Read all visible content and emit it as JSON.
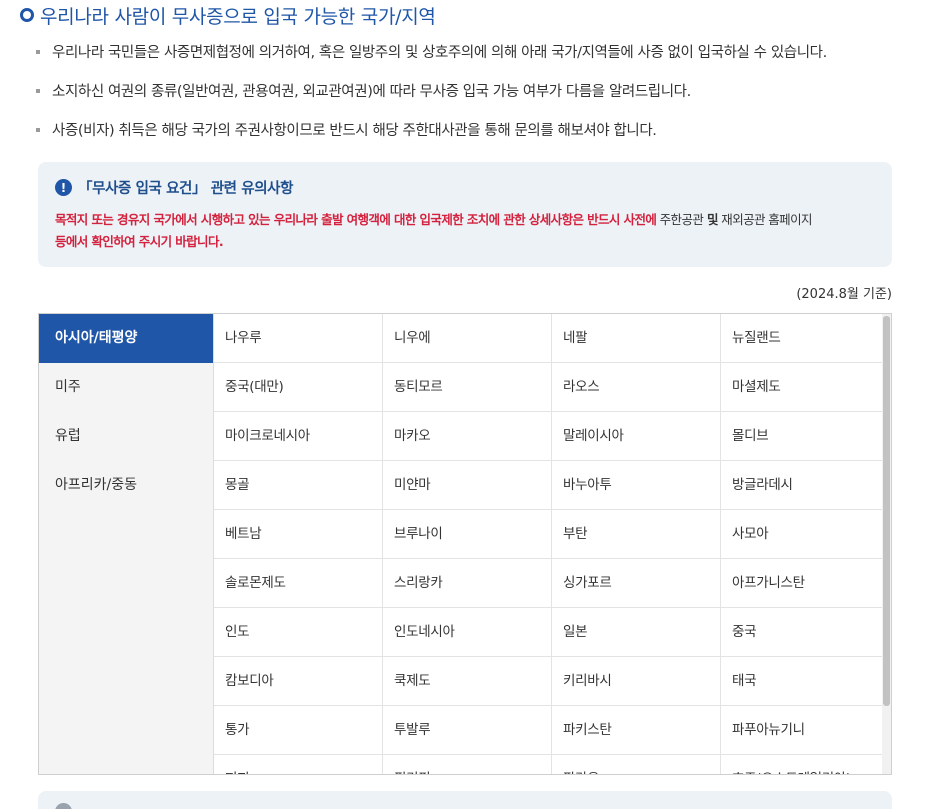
{
  "title": "우리나라 사람이 무사증으로 입국 가능한 국가/지역",
  "bullets": [
    "우리나라 국민들은 사증면제협정에 의거하여, 혹은 일방주의 및 상호주의에 의해 아래 국가/지역들에 사증 없이 입국하실 수 있습니다.",
    "소지하신 여권의 종류(일반여권, 관용여권, 외교관여권)에 따라 무사증 입국 가능 여부가 다름을 알려드립니다.",
    "사증(비자) 취득은 해당 국가의 주권사항이므로 반드시 해당 주한대사관을 통해 문의를 해보셔야 합니다."
  ],
  "notice": {
    "icon": "exclamation-icon",
    "title": "「무사증 입국 요건」 관련 유의사항",
    "body_red": "목적지 또는 경유지 국가에서 시행하고 있는 우리나라 출발 여행객에 대한 입국제한 조치에 관한 상세사항은 반드시 사전에",
    "body_normal_1": " 주한공관",
    "body_bold_and": " 및",
    "body_normal_2": " 재외공관 홈페이지",
    "body_red_2": "등에서 확인하여 주시기 바랍니다."
  },
  "basis_date": "(2024.8월 기준)",
  "regions": [
    {
      "label": "아시아/태평양",
      "active": true
    },
    {
      "label": "미주",
      "active": false
    },
    {
      "label": "유럽",
      "active": false
    },
    {
      "label": "아프리카/중동",
      "active": false
    }
  ],
  "countries": [
    [
      "나우루",
      "니우에",
      "네팔",
      "뉴질랜드"
    ],
    [
      "중국(대만)",
      "동티모르",
      "라오스",
      "마셜제도"
    ],
    [
      "마이크로네시아",
      "마카오",
      "말레이시아",
      "몰디브"
    ],
    [
      "몽골",
      "미얀마",
      "바누아투",
      "방글라데시"
    ],
    [
      "베트남",
      "브루나이",
      "부탄",
      "사모아"
    ],
    [
      "솔로몬제도",
      "스리랑카",
      "싱가포르",
      "아프가니스탄"
    ],
    [
      "인도",
      "인도네시아",
      "일본",
      "중국"
    ],
    [
      "캄보디아",
      "쿡제도",
      "키리바시",
      "태국"
    ],
    [
      "통가",
      "투발루",
      "파키스탄",
      "파푸아뉴기니"
    ],
    [
      "피지",
      "필리핀",
      "팔라우",
      "호주(오스트레일리아)"
    ]
  ],
  "colors": {
    "accent": "#1f56a8",
    "notice_bg": "#edf2f7",
    "warning_red": "#d4213d"
  }
}
